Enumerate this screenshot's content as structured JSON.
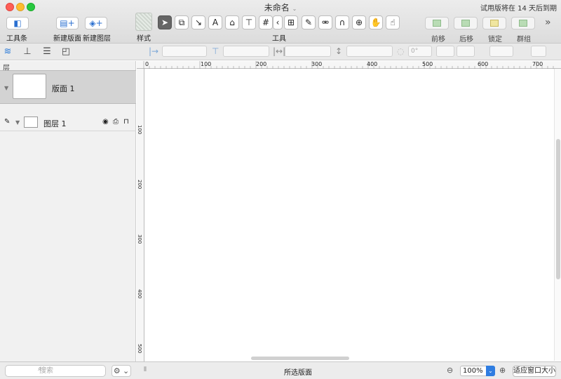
{
  "window": {
    "title": "未命名",
    "trial_notice": "试用版将在 14 天后到期"
  },
  "toolbar": {
    "toolbar_toggle": "工具条",
    "new_canvas": "新建版面",
    "new_layer": "新建图层",
    "style": "样式",
    "tools": "工具",
    "bring_forward": "前移",
    "send_backward": "后移",
    "lock": "锁定",
    "group": "群组",
    "overflow": "»"
  },
  "inspector": {
    "rotation_value": "0°"
  },
  "sidebar": {
    "header": "层",
    "canvas_name": "版面 1",
    "layer_name": "图层 1"
  },
  "rulers": {
    "top": [
      "0",
      "100",
      "200",
      "300",
      "400",
      "500",
      "600",
      "700"
    ],
    "left": [
      "100",
      "200",
      "300",
      "400",
      "500"
    ]
  },
  "status": {
    "search_placeholder": "搜索",
    "selection_label": "所选版面",
    "zoom_value": "100%",
    "fit_label": "适应窗口大小"
  }
}
